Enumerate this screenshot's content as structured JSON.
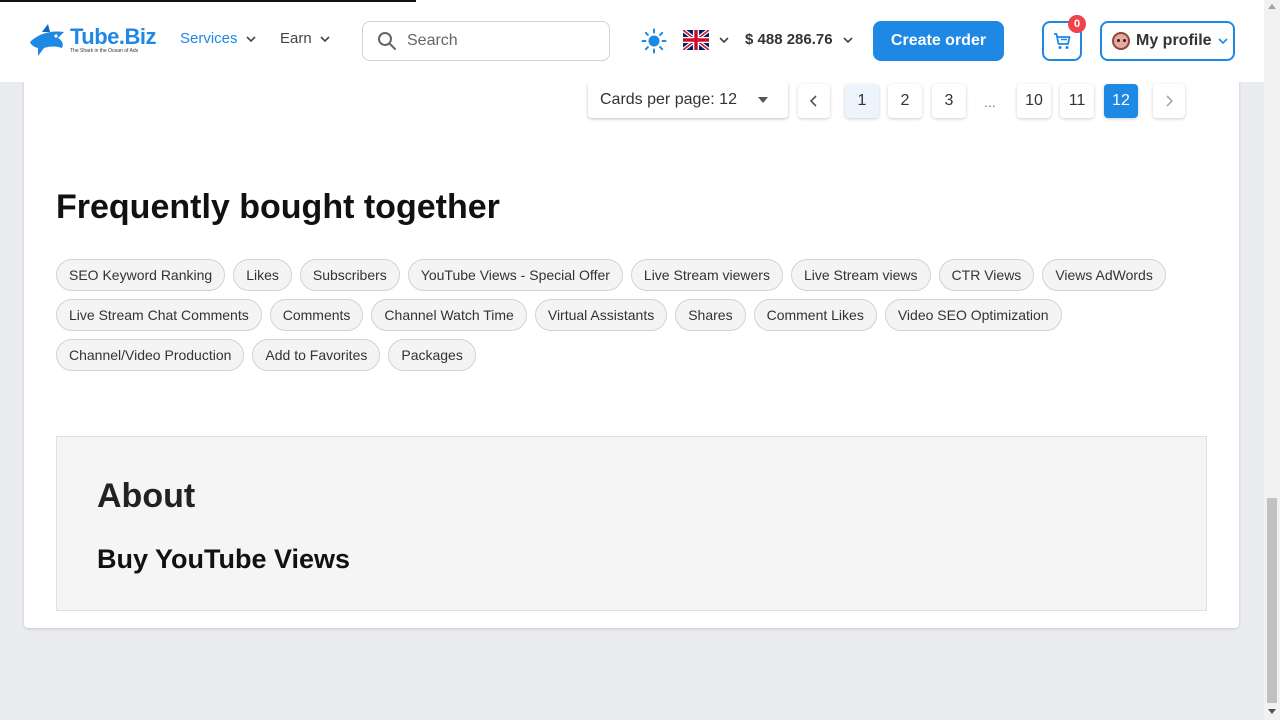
{
  "header": {
    "logo": {
      "name": "Tube.Biz",
      "tagline": "The Shark in the Ocean of Ads"
    },
    "nav": [
      {
        "label": "Services",
        "active": true
      },
      {
        "label": "Earn",
        "active": false
      }
    ],
    "search": {
      "placeholder": "Search",
      "value": ""
    },
    "theme_icon": "sun-icon",
    "language_icon": "uk-flag-icon",
    "balance": "$ 488 286.76",
    "create_order_label": "Create order",
    "cart": {
      "icon": "cart-icon",
      "count": "0"
    },
    "profile_label": "My profile"
  },
  "pagination": {
    "cards_per_page": "Cards per page: 12",
    "pages": [
      "1",
      "2",
      "3",
      "10",
      "11",
      "12"
    ],
    "ellipsis": "...",
    "current_page": "12"
  },
  "frequently_bought": {
    "title": "Frequently bought together",
    "tags": [
      "SEO Keyword Ranking",
      "Likes",
      "Subscribers",
      "YouTube Views - Special Offer",
      "Live Stream viewers",
      "Live Stream views",
      "CTR Views",
      "Views AdWords",
      "Live Stream Chat Comments",
      "Comments",
      "Channel Watch Time",
      "Virtual Assistants",
      "Shares",
      "Comment Likes",
      "Video SEO Optimization",
      "Channel/Video Production",
      "Add to Favorites",
      "Packages"
    ]
  },
  "about": {
    "title": "About",
    "subtitle": "Buy YouTube Views"
  },
  "colors": {
    "accent": "#1e88e5",
    "badge": "#f0424a",
    "page_bg": "#eaecf0"
  }
}
